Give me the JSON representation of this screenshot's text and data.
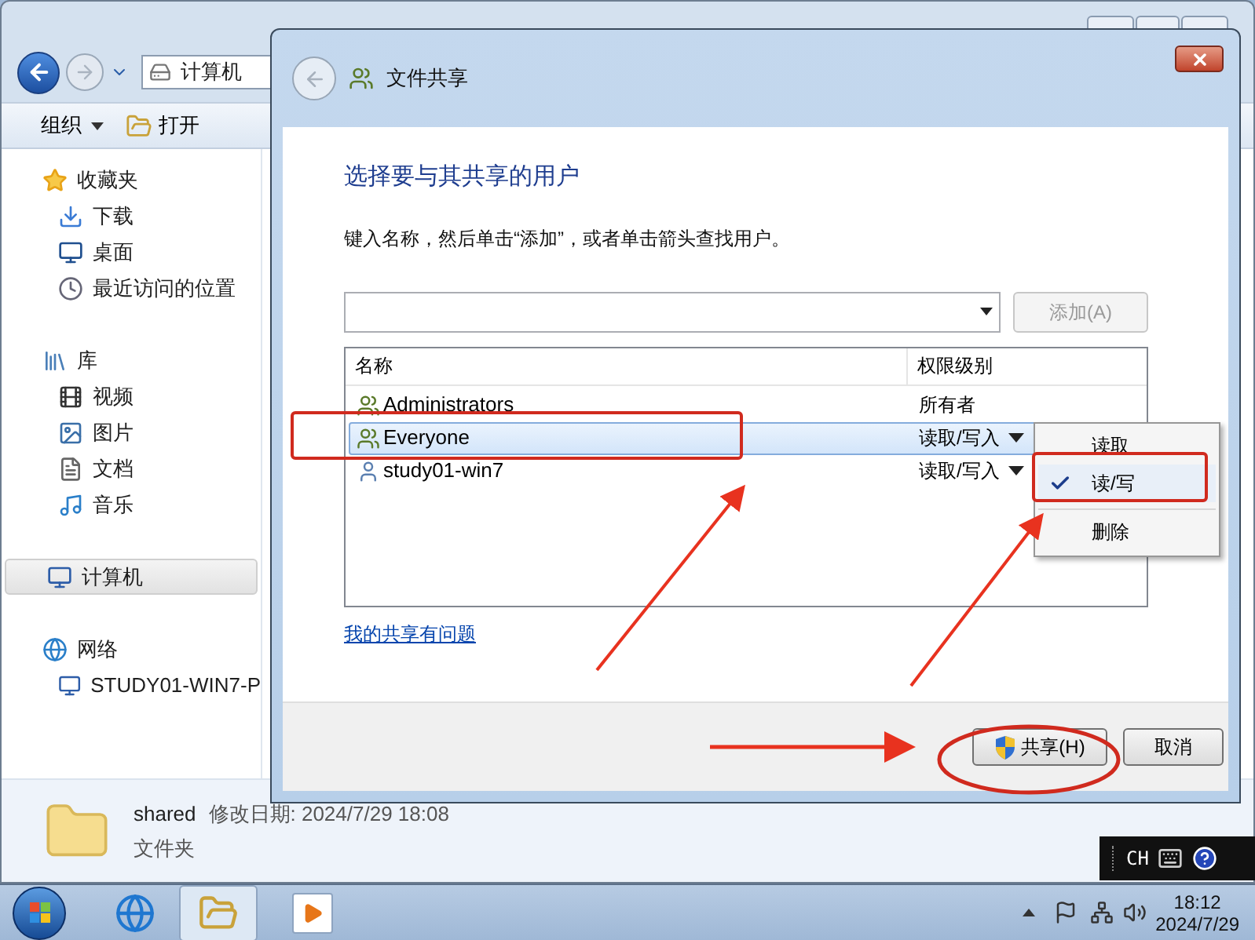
{
  "explorer": {
    "address_path": [
      "计算机"
    ],
    "toolbar": [
      {
        "label": "组织",
        "has_menu": true
      },
      {
        "label": "打开",
        "has_menu": false
      }
    ],
    "nav": [
      {
        "label": "收藏夹",
        "selected": false,
        "children": [
          {
            "label": "下载",
            "selected": false
          },
          {
            "label": "桌面",
            "selected": false
          },
          {
            "label": "最近访问的位置",
            "selected": false
          }
        ]
      },
      {
        "label": "库",
        "selected": false,
        "children": [
          {
            "label": "视频",
            "selected": false
          },
          {
            "label": "图片",
            "selected": false
          },
          {
            "label": "文档",
            "selected": false
          },
          {
            "label": "音乐",
            "selected": false
          }
        ]
      },
      {
        "label": "计算机",
        "selected": true
      },
      {
        "label": "网络",
        "selected": false,
        "children": [
          {
            "label": "STUDY01-WIN7-P",
            "selected": false
          }
        ]
      }
    ],
    "details": {
      "name": "shared",
      "modified": "修改日期: 2024/7/29 18:08",
      "type": "文件夹"
    }
  },
  "dialog": {
    "title": "文件共享",
    "heading": "选择要与其共享的用户",
    "instruction": "键入名称，然后单击“添加”，或者单击箭头查找用户。",
    "add_button": {
      "label": "添加(A)",
      "disabled": true
    },
    "columns": [
      "名称",
      "权限级别"
    ],
    "rows": [
      {
        "name": "Administrators",
        "permission": "所有者",
        "kind": "group",
        "has_dropdown": false,
        "selected": false
      },
      {
        "name": "Everyone",
        "permission": "读取/写入",
        "kind": "group",
        "has_dropdown": true,
        "selected": true
      },
      {
        "name": "study01-win7",
        "permission": "读取/写入",
        "kind": "user",
        "has_dropdown": true,
        "selected": false
      }
    ],
    "menu": [
      {
        "label": "读取",
        "checked": false,
        "separated": false
      },
      {
        "label": "读/写",
        "checked": true,
        "separated": false
      },
      {
        "label": "删除",
        "checked": false,
        "separated": true
      }
    ],
    "link": "我的共享有问题",
    "buttons": [
      {
        "label": "共享(H)",
        "kind": "shield"
      },
      {
        "label": "取消",
        "kind": "plain"
      }
    ]
  },
  "language_bar": {
    "label": "CH"
  },
  "clock": {
    "time": "18:12",
    "date": "2024/7/29"
  }
}
